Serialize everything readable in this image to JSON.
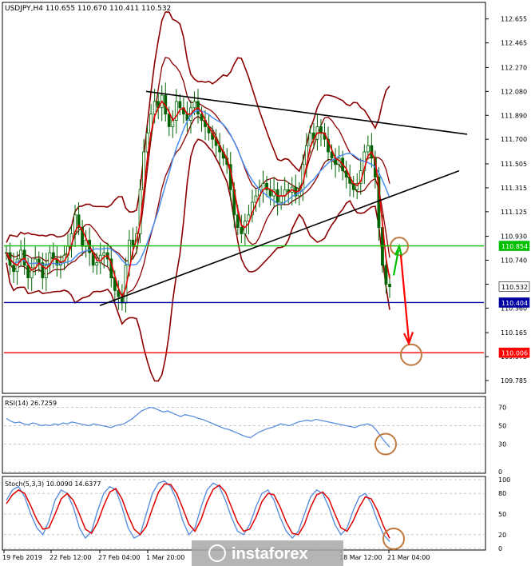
{
  "header": {
    "title": "USDJPY,H4  110.655 110.670 110.411 110.532",
    "menu_glyph": "▼"
  },
  "rsi_header": "RSI(14) 26.7259",
  "stoch_header": "Stoch(5,3,3) 10.0090 14.6377",
  "watermark": "instaforex",
  "colors": {
    "candle": "#006400",
    "ma_red": "#e00000",
    "ma_blue": "#4a8ff0",
    "band": "#8b0000",
    "green_level": "#00c000",
    "blue_level": "#0000a0",
    "red_level": "#ff0000",
    "circle": "#c07a40",
    "rsi_line": "#5b8fdc",
    "stoch_main": "#5b8fdc",
    "stoch_signal": "#e00000"
  },
  "chart_data": [
    {
      "type": "candlestick",
      "title": "USDJPY,H4",
      "ohlc_last": {
        "open": 110.655,
        "high": 110.67,
        "low": 110.411,
        "close": 110.532
      },
      "ylim": [
        109.69,
        112.78
      ],
      "y_ticks": [
        "112.655",
        "112.465",
        "112.270",
        "112.080",
        "111.890",
        "111.700",
        "111.505",
        "111.315",
        "111.125",
        "110.930",
        "110.740",
        "110.550",
        "110.360",
        "110.165",
        "109.975",
        "109.785"
      ],
      "x_ticks": [
        "19 Feb 2019",
        "22 Feb 12:00",
        "27 Feb 04:00",
        "1 Mar 20:00",
        "18 Mar 12:00",
        "21 Mar 04:00"
      ],
      "price_labels": [
        {
          "value": 110.854,
          "text": "110.854",
          "color": "#00c000"
        },
        {
          "value": 110.532,
          "text": "110.532",
          "color": "#ffffff"
        },
        {
          "value": 110.404,
          "text": "110.404",
          "color": "#0000a0"
        },
        {
          "value": 110.006,
          "text": "110.006",
          "color": "#ff0000"
        }
      ],
      "levels": [
        {
          "value": 110.854,
          "color": "#00c000"
        },
        {
          "value": 110.404,
          "color": "#0000a0"
        },
        {
          "value": 110.006,
          "color": "#ff0000"
        }
      ],
      "close_series": [
        110.8,
        110.7,
        110.65,
        110.75,
        110.82,
        110.7,
        110.6,
        110.68,
        110.75,
        110.72,
        110.6,
        110.7,
        110.8,
        110.75,
        110.7,
        110.72,
        110.78,
        110.85,
        110.95,
        111.1,
        111.0,
        110.85,
        110.9,
        110.8,
        110.7,
        110.72,
        110.78,
        110.8,
        110.75,
        110.6,
        110.5,
        110.45,
        110.4,
        110.7,
        110.9,
        110.85,
        110.95,
        111.3,
        111.6,
        111.75,
        111.9,
        112.0,
        111.95,
        112.05,
        111.9,
        111.8,
        111.85,
        112.0,
        111.95,
        111.9,
        111.85,
        111.95,
        112.0,
        111.9,
        111.85,
        111.8,
        111.75,
        111.7,
        111.65,
        111.6,
        111.55,
        111.5,
        111.3,
        111.1,
        111.0,
        110.95,
        111.05,
        111.1,
        111.2,
        111.25,
        111.3,
        111.35,
        111.3,
        111.25,
        111.3,
        111.2,
        111.25,
        111.3,
        111.28,
        111.32,
        111.25,
        111.3,
        111.5,
        111.65,
        111.75,
        111.7,
        111.8,
        111.75,
        111.7,
        111.6,
        111.55,
        111.5,
        111.55,
        111.45,
        111.4,
        111.35,
        111.3,
        111.35,
        111.45,
        111.6,
        111.65,
        111.55,
        111.4,
        111.0,
        110.7,
        110.55,
        110.53
      ],
      "trendlines": [
        {
          "from": [
            "1 Mar",
            112.08
          ],
          "to": [
            "end",
            111.74
          ],
          "label": ""
        },
        {
          "from": [
            "27 Feb",
            110.38
          ],
          "to": [
            "end",
            111.45
          ],
          "label": ""
        }
      ]
    },
    {
      "type": "line",
      "title": "RSI(14) 26.7259",
      "ylim": [
        0,
        80
      ],
      "y_ticks": [
        "70",
        "50",
        "30",
        "0"
      ],
      "values": [
        58,
        55,
        53,
        54,
        52,
        51,
        53,
        52,
        50,
        51,
        50,
        52,
        51,
        53,
        52,
        54,
        53,
        52,
        51,
        50,
        52,
        51,
        50,
        49,
        48,
        50,
        51,
        52,
        55,
        58,
        62,
        66,
        68,
        70,
        69,
        67,
        65,
        66,
        64,
        62,
        60,
        62,
        61,
        60,
        58,
        57,
        55,
        53,
        51,
        49,
        47,
        46,
        44,
        42,
        40,
        38,
        37,
        40,
        43,
        45,
        47,
        48,
        50,
        52,
        51,
        50,
        52,
        54,
        55,
        56,
        55,
        57,
        56,
        55,
        54,
        53,
        52,
        51,
        50,
        49,
        48,
        50,
        51,
        52,
        50,
        45,
        38,
        32,
        26.7
      ]
    },
    {
      "type": "line",
      "title": "Stoch(5,3,3) 10.0090 14.6377",
      "ylim": [
        0,
        100
      ],
      "y_ticks": [
        "100",
        "80",
        "50",
        "20",
        "0"
      ],
      "main": [
        70,
        85,
        90,
        75,
        50,
        30,
        20,
        40,
        70,
        85,
        80,
        60,
        30,
        15,
        25,
        55,
        80,
        90,
        85,
        60,
        30,
        15,
        20,
        50,
        80,
        95,
        98,
        90,
        70,
        40,
        20,
        30,
        60,
        85,
        95,
        90,
        70,
        45,
        25,
        20,
        35,
        60,
        80,
        85,
        70,
        45,
        25,
        15,
        25,
        50,
        75,
        85,
        80,
        60,
        35,
        20,
        30,
        55,
        75,
        80,
        65,
        40,
        20,
        10
      ],
      "signal": [
        65,
        78,
        85,
        80,
        62,
        42,
        28,
        30,
        50,
        72,
        80,
        70,
        50,
        28,
        22,
        38,
        62,
        82,
        87,
        72,
        48,
        28,
        20,
        32,
        58,
        82,
        94,
        93,
        80,
        58,
        35,
        25,
        42,
        68,
        86,
        92,
        82,
        60,
        38,
        25,
        28,
        45,
        68,
        80,
        78,
        60,
        38,
        22,
        20,
        35,
        60,
        78,
        82,
        72,
        50,
        30,
        25,
        40,
        60,
        75,
        72,
        55,
        32,
        14.6
      ]
    }
  ]
}
